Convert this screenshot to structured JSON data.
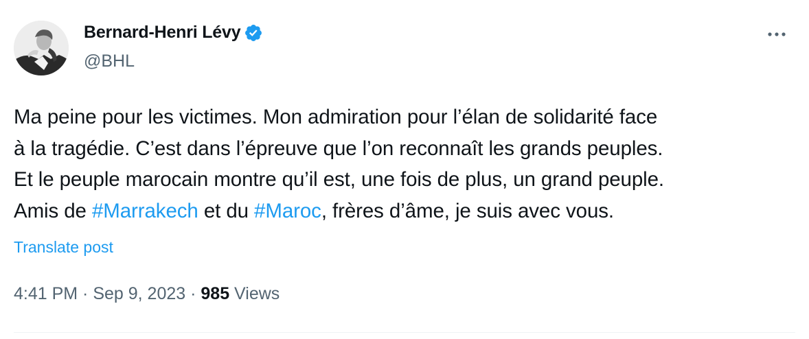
{
  "author": {
    "display_name": "Bernard-Henri Lévy",
    "handle": "@BHL",
    "verified_color": "#1d9bf0"
  },
  "tweet": {
    "segments": {
      "l1": "Ma peine pour les victimes. Mon admiration pour l’élan de solidarité face",
      "l2": "à la tragédie. C’est dans l’épreuve que l’on reconnaît les grands peuples.",
      "l3": "Et le peuple marocain montre qu’il est, une fois de plus, un grand peuple.",
      "l4_pre": "Amis de ",
      "tag1": "#Marrakech",
      "l4_mid": " et du ",
      "tag2": "#Maroc",
      "l4_post": ", frères d’âme, je suis avec vous."
    },
    "translate_label": "Translate post"
  },
  "meta": {
    "time": "4:41 PM",
    "separator": " · ",
    "date": "Sep 9, 2023",
    "views_count": "985",
    "views_label": " Views"
  },
  "icons": {
    "more": "more-options-icon",
    "verified": "verified-badge-icon",
    "avatar": "profile-photo"
  },
  "colors": {
    "link": "#1d9bf0",
    "secondary_text": "#536471",
    "primary_text": "#0f1419"
  }
}
